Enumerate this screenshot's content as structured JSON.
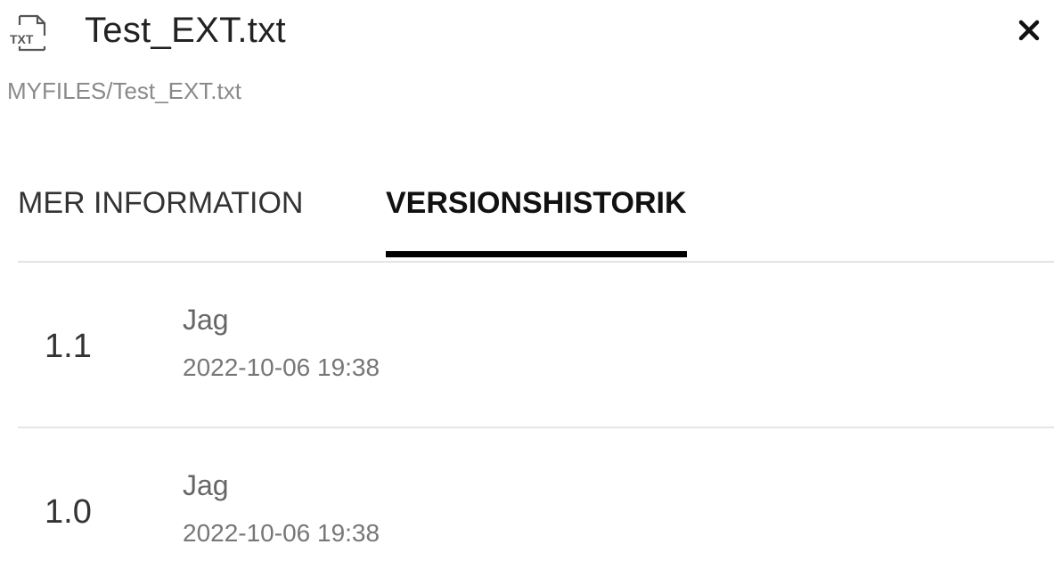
{
  "header": {
    "file_icon": "txt-file-icon",
    "file_icon_text": "TXT",
    "title": "Test_EXT.txt",
    "close_icon": "close-icon",
    "close_glyph": "✕",
    "path": "MYFILES/Test_EXT.txt"
  },
  "tabs": [
    {
      "label": "MER INFORMATION",
      "active": false
    },
    {
      "label": "VERSIONSHISTORIK",
      "active": true
    }
  ],
  "versions": [
    {
      "number": "1.1",
      "author": "Jag",
      "date": "2022-10-06 19:38"
    },
    {
      "number": "1.0",
      "author": "Jag",
      "date": "2022-10-06 19:38"
    }
  ],
  "colors": {
    "active_tab_underline": "#000000",
    "divider": "#e4e4e4",
    "muted_text": "#8a8a8a"
  }
}
